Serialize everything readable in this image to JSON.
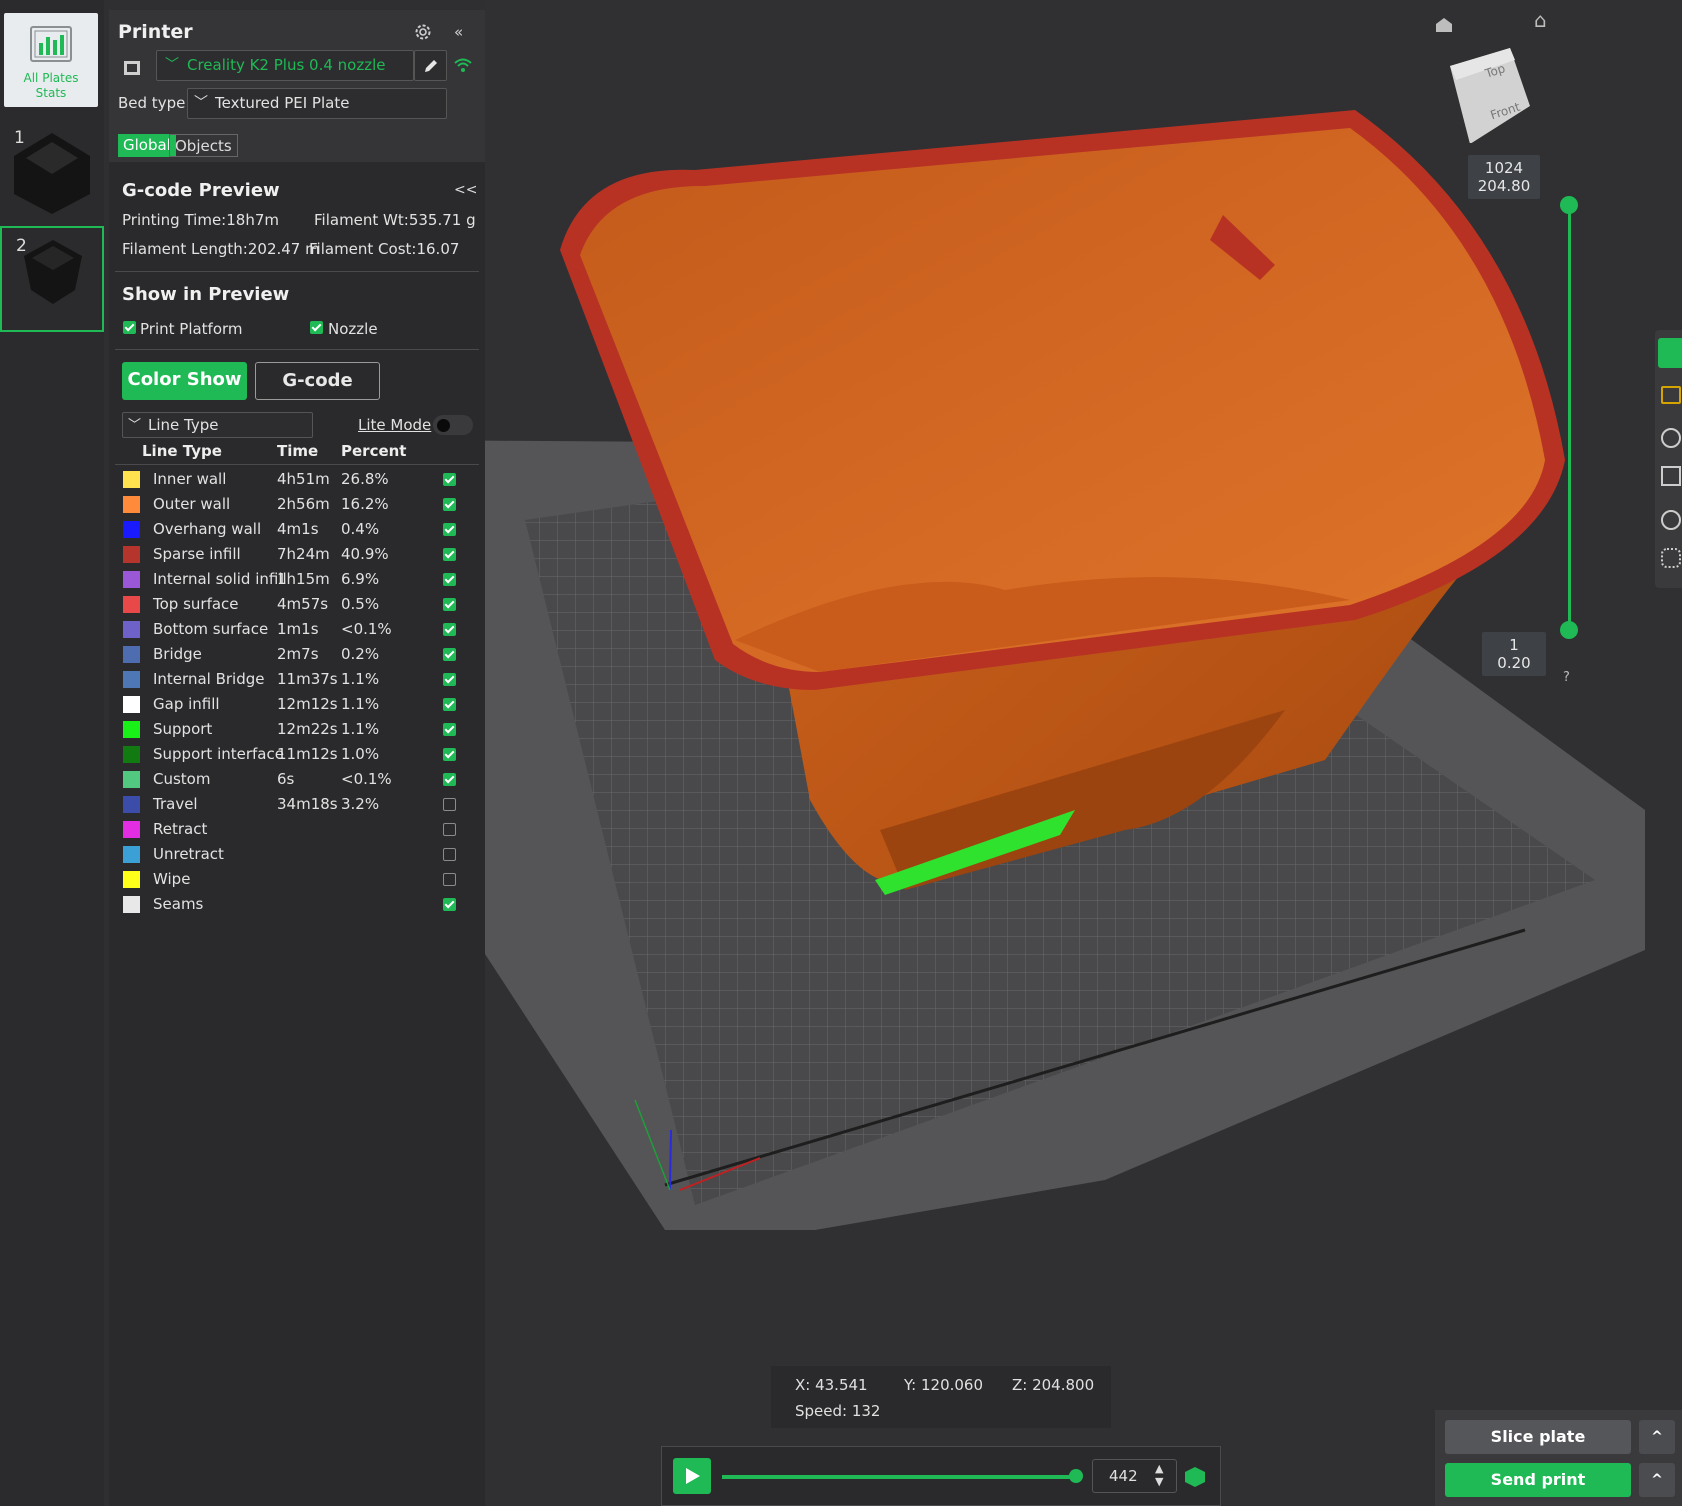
{
  "sidebar": {
    "all_plates_stats": "All Plates\nStats",
    "plates": [
      {
        "number": "1"
      },
      {
        "number": "2",
        "selected": true
      }
    ]
  },
  "printer": {
    "title": "Printer",
    "printer_name": "Creality K2 Plus 0.4 nozzle",
    "bed_type_label": "Bed type",
    "bed_type_value": "Textured PEI Plate",
    "tab_global": "Global",
    "tab_objects": "Objects"
  },
  "gcode_preview": {
    "title": "G-code Preview",
    "collapse": "<<",
    "printing_time": "Printing Time:18h7m",
    "filament_weight": "Filament Wt:535.71 g",
    "filament_length": "Filament Length:202.47 m",
    "filament_cost": "Filament Cost:16.07"
  },
  "show_in_preview": {
    "title": "Show in Preview",
    "print_platform": "Print Platform",
    "nozzle": "Nozzle"
  },
  "view_mode": {
    "color_show": "Color Show",
    "gcode": "G-code",
    "selector": "Line Type",
    "lite_mode": "Lite Mode"
  },
  "legend": {
    "headers": [
      "Line Type",
      "Time",
      "Percent"
    ],
    "rows": [
      {
        "name": "Inner wall",
        "time": "4h51m",
        "percent": "26.8%",
        "color": "#ffe24d",
        "checked": true
      },
      {
        "name": "Outer wall",
        "time": "2h56m",
        "percent": "16.2%",
        "color": "#ff8a3a",
        "checked": true
      },
      {
        "name": "Overhang wall",
        "time": "4m1s",
        "percent": "0.4%",
        "color": "#1a1aff",
        "checked": true
      },
      {
        "name": "Sparse infill",
        "time": "7h24m",
        "percent": "40.9%",
        "color": "#b5342c",
        "checked": true
      },
      {
        "name": "Internal solid infill",
        "time": "1h15m",
        "percent": "6.9%",
        "color": "#9b58d6",
        "checked": true
      },
      {
        "name": "Top surface",
        "time": "4m57s",
        "percent": "0.5%",
        "color": "#e84848",
        "checked": true
      },
      {
        "name": "Bottom surface",
        "time": "1m1s",
        "percent": "<0.1%",
        "color": "#6e62c8",
        "checked": true
      },
      {
        "name": "Bridge",
        "time": "2m7s",
        "percent": "0.2%",
        "color": "#4d6db0",
        "checked": true
      },
      {
        "name": "Internal Bridge",
        "time": "11m37s",
        "percent": "1.1%",
        "color": "#4d78b5",
        "checked": true
      },
      {
        "name": "Gap infill",
        "time": "12m12s",
        "percent": "1.1%",
        "color": "#ffffff",
        "checked": true
      },
      {
        "name": "Support",
        "time": "12m22s",
        "percent": "1.1%",
        "color": "#18f018",
        "checked": true
      },
      {
        "name": "Support interface",
        "time": "11m12s",
        "percent": "1.0%",
        "color": "#117a11",
        "checked": true
      },
      {
        "name": "Custom",
        "time": "6s",
        "percent": "<0.1%",
        "color": "#52c77f",
        "checked": true
      },
      {
        "name": "Travel",
        "time": "34m18s",
        "percent": "3.2%",
        "color": "#3b4da8",
        "checked": false
      },
      {
        "name": "Retract",
        "time": "",
        "percent": "",
        "color": "#e22de2",
        "checked": false
      },
      {
        "name": "Unretract",
        "time": "",
        "percent": "",
        "color": "#3aa0d6",
        "checked": false
      },
      {
        "name": "Wipe",
        "time": "",
        "percent": "",
        "color": "#ffff1a",
        "checked": false
      },
      {
        "name": "Seams",
        "time": "",
        "percent": "",
        "color": "#e8e8e8",
        "checked": true
      }
    ]
  },
  "viewport": {
    "cube_top": "Top",
    "cube_front": "Front",
    "layer_top_num": "1024",
    "layer_top_height": "204.80",
    "layer_bottom_num": "1",
    "layer_bottom_height": "0.20",
    "help": "?",
    "coords_x": "X: 43.541",
    "coords_y": "Y: 120.060",
    "coords_z": "Z: 204.800",
    "speed": "Speed: 132",
    "move_value": "442",
    "move_progress": 0.99,
    "slice_plate": "Slice plate",
    "send_print": "Send print",
    "accent": "#1fb955"
  }
}
